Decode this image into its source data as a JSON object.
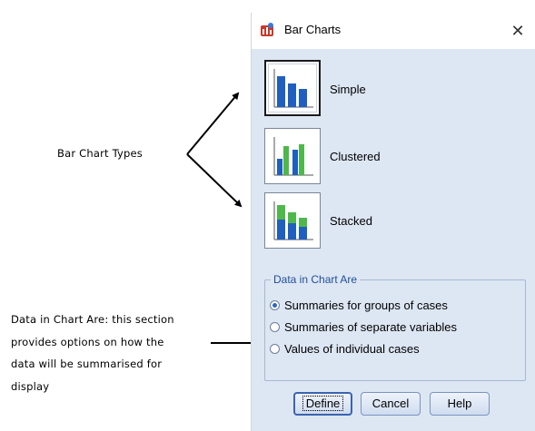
{
  "annotations": {
    "types_label": "Bar Chart Types",
    "data_desc_lines": [
      "Data in Chart Are:  this section",
      "provides options on how the",
      "data will be summarised for",
      "display"
    ]
  },
  "dialog": {
    "title": "Bar Charts",
    "chart_types": [
      {
        "label": "Simple",
        "selected": true
      },
      {
        "label": "Clustered",
        "selected": false
      },
      {
        "label": "Stacked",
        "selected": false
      }
    ],
    "group_title": "Data in Chart Are",
    "options": [
      {
        "label": "Summaries for groups of cases",
        "checked": true
      },
      {
        "label": "Summaries of separate variables",
        "checked": false
      },
      {
        "label": "Values of individual cases",
        "checked": false
      }
    ],
    "buttons": {
      "define": "Define",
      "cancel": "Cancel",
      "help": "Help"
    }
  },
  "colors": {
    "dialog_bg": "#dde6f3",
    "bar_blue": "#1f5fbf",
    "bar_green": "#4fb84a",
    "group_title": "#1f4f99"
  }
}
